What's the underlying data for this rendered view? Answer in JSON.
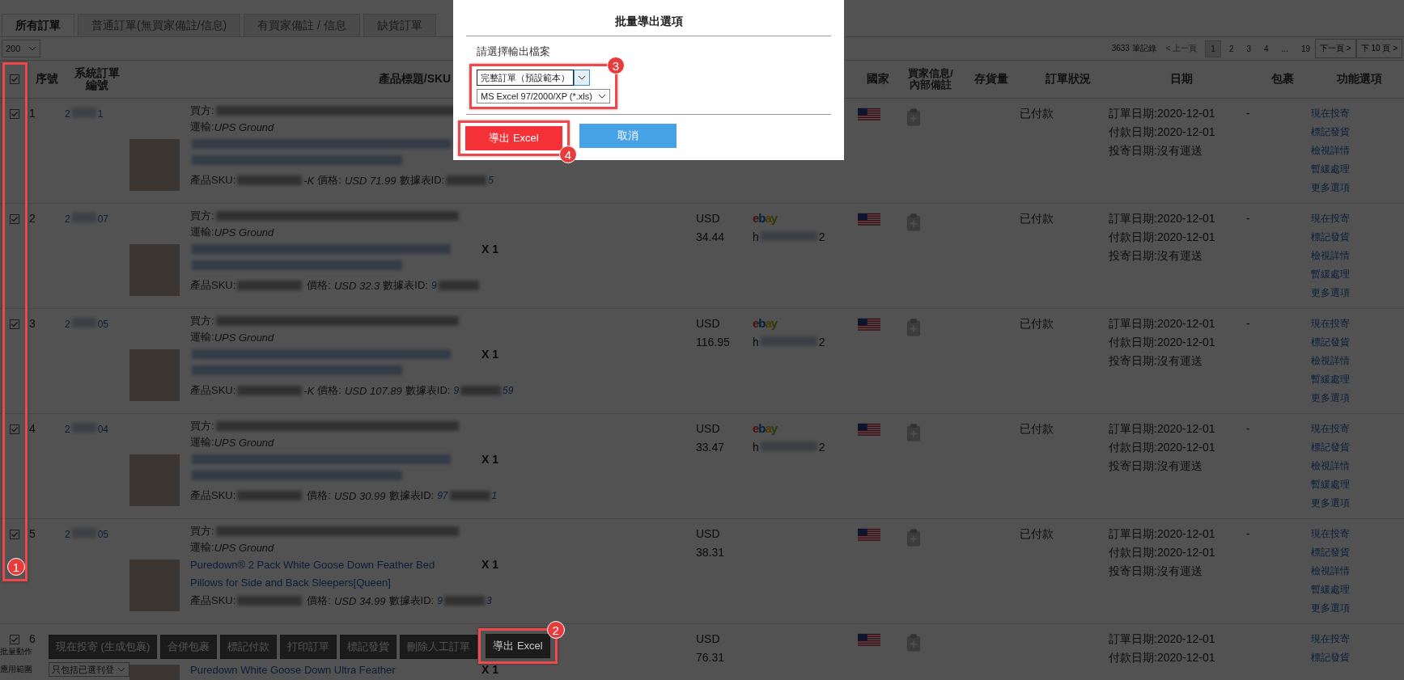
{
  "tabs": [
    {
      "label": "所有訂單",
      "selected": true
    },
    {
      "label": "普通訂單(無買家備註/信息)",
      "selected": false
    },
    {
      "label": "有買家備註 / 信息",
      "selected": false
    },
    {
      "label": "缺貨訂單",
      "selected": false
    }
  ],
  "page_size": "200",
  "pagination": {
    "total": "3633 筆記錄",
    "prev": "< 上一頁",
    "pages": [
      {
        "label": "1",
        "selected": true
      },
      {
        "label": "2",
        "selected": false
      },
      {
        "label": "3",
        "selected": false
      },
      {
        "label": "4",
        "selected": false
      },
      {
        "label": "...",
        "selected": false
      },
      {
        "label": "19",
        "selected": false
      }
    ],
    "next": "下一頁 >",
    "next10": "下 10 頁 >"
  },
  "table": {
    "all_checked": true,
    "columns_left": [
      "序號",
      "系統訂單編號",
      "產品標題/SKU"
    ],
    "columns_right": [
      "國家",
      "買家信息/內部備註",
      "存貨量",
      "訂單狀況",
      "日期",
      "包裹",
      "功能選項"
    ],
    "rows": [
      {
        "checked": true,
        "index": "1",
        "order_id_start": "2",
        "order_id_end": "1",
        "buyer_label": "買方:",
        "shipping_label": "運輸:",
        "shipping": "UPS Ground",
        "sku_label": "產品SKU:",
        "sku_end": "-K",
        "price_label": "價格:",
        "price": "USD 71.99",
        "dataid_label": "數據表ID:",
        "dataid_end": "5",
        "status": "已付款",
        "dates": [
          "訂單日期:2020-12-01",
          "付款日期:2020-12-01",
          "投寄日期:沒有運送"
        ],
        "package": "-",
        "actions": [
          "現在投寄",
          "標記發貨",
          "檢視詳情",
          "暫緩處理",
          "更多選項"
        ]
      },
      {
        "checked": true,
        "index": "2",
        "order_id_start": "2",
        "order_id_end": "07",
        "buyer_label": "買方:",
        "shipping_label": "運輸:",
        "shipping": "UPS Ground",
        "sku_label": "產品SKU:",
        "price_label": "價格:",
        "price": "USD 32.3",
        "dataid_label": "數據表ID:",
        "dataid_start": "9",
        "qty": "X 1",
        "currency": "USD",
        "amount": "34.44",
        "store": "ebay",
        "seller_start": "h",
        "seller_end": "2",
        "status": "已付款",
        "dates": [
          "訂單日期:2020-12-01",
          "付款日期:2020-12-01",
          "投寄日期:沒有運送"
        ],
        "package": "-",
        "actions": [
          "現在投寄",
          "標記發貨",
          "檢視詳情",
          "暫緩處理",
          "更多選項"
        ]
      },
      {
        "checked": true,
        "index": "3",
        "order_id_start": "2",
        "order_id_end": "05",
        "buyer_label": "買方:",
        "shipping_label": "運輸:",
        "shipping": "UPS Ground",
        "sku_label": "產品SKU:",
        "sku_end": "-K",
        "price_label": "價格:",
        "price": "USD 107.89",
        "dataid_label": "數據表ID:",
        "dataid_start": "9",
        "dataid_end": "59",
        "qty": "X 1",
        "currency": "USD",
        "amount": "116.95",
        "store": "ebay",
        "seller_start": "h",
        "seller_end": "2",
        "status": "已付款",
        "dates": [
          "訂單日期:2020-12-01",
          "付款日期:2020-12-01",
          "投寄日期:沒有運送"
        ],
        "package": "-",
        "actions": [
          "現在投寄",
          "標記發貨",
          "檢視詳情",
          "暫緩處理",
          "更多選項"
        ]
      },
      {
        "checked": true,
        "index": "4",
        "order_id_start": "2",
        "order_id_end": "04",
        "buyer_label": "買方:",
        "shipping_label": "運輸:",
        "shipping": "UPS Ground",
        "sku_label": "產品SKU:",
        "price_label": "價格:",
        "price": "USD 30.99",
        "dataid_label": "數據表ID:",
        "dataid_start": "97",
        "dataid_end": "1",
        "qty": "X 1",
        "currency": "USD",
        "amount": "33.47",
        "store": "ebay",
        "seller_start": "h",
        "seller_end": "2",
        "status": "已付款",
        "dates": [
          "訂單日期:2020-12-01",
          "付款日期:2020-12-01",
          "投寄日期:沒有運送"
        ],
        "package": "-",
        "actions": [
          "現在投寄",
          "標記發貨",
          "檢視詳情",
          "暫緩處理",
          "更多選項"
        ]
      },
      {
        "checked": true,
        "index": "5",
        "order_id_start": "2",
        "order_id_end": "05",
        "buyer_label": "買方:",
        "shipping_label": "運輸:",
        "shipping": "UPS Ground",
        "title": "Puredown® 2 Pack White Goose Down Feather Bed Pillows for Side and Back Sleepers[Queen]",
        "sku_label": "產品SKU:",
        "price_label": "價格:",
        "price": "USD 34.99",
        "dataid_label": "數據表ID:",
        "dataid_start": "9",
        "dataid_end": "3",
        "qty": "X 1",
        "currency": "USD",
        "amount": "38.31",
        "status": "已付款",
        "dates": [
          "訂單日期:2020-12-01",
          "付款日期:2020-12-01",
          "投寄日期:沒有運送"
        ],
        "package": "-",
        "actions": [
          "現在投寄",
          "標記發貨",
          "檢視詳情",
          "暫緩處理",
          "更多選項"
        ]
      },
      {
        "checked": true,
        "index": "6",
        "title": "Puredown White Goose Down Ultra Feather",
        "qty": "X 1",
        "currency": "USD",
        "amount": "76.31",
        "dates": [
          "訂單日期:2020-12-01",
          "付款日期:2020-12-01"
        ],
        "actions": [
          "現在投寄",
          "標記發貨"
        ]
      }
    ]
  },
  "bulk": {
    "label": "批量動作",
    "buttons": [
      "現在投寄 (生成包裹)",
      "合併包裹",
      "標記付款",
      "打印訂單",
      "標記發貨",
      "刪除人工訂單",
      "導出 Excel"
    ],
    "scope_label": "應用範圍",
    "scope": "只包括已選刊登"
  },
  "dialog": {
    "title": "批量導出選項",
    "prompt": "請選擇輸出檔案",
    "template": "完整訂單（預設範本）",
    "format": "MS Excel 97/2000/XP (*.xls)",
    "buttons": [
      {
        "label": "導出 Excel",
        "kind": "primary"
      },
      {
        "label": "取消",
        "kind": "secondary"
      }
    ]
  },
  "annotations": [
    "1",
    "2",
    "3",
    "4"
  ]
}
